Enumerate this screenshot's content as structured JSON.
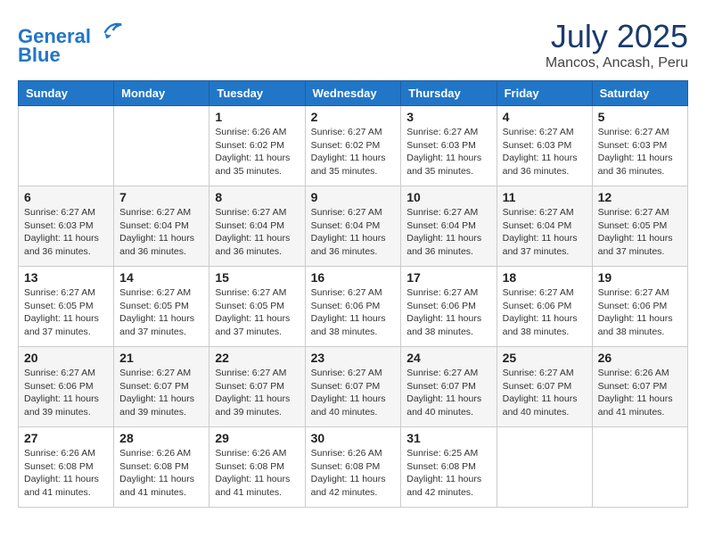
{
  "header": {
    "logo_line1": "General",
    "logo_line2": "Blue",
    "month": "July 2025",
    "location": "Mancos, Ancash, Peru"
  },
  "weekdays": [
    "Sunday",
    "Monday",
    "Tuesday",
    "Wednesday",
    "Thursday",
    "Friday",
    "Saturday"
  ],
  "weeks": [
    [
      {
        "day": "",
        "info": ""
      },
      {
        "day": "",
        "info": ""
      },
      {
        "day": "1",
        "info": "Sunrise: 6:26 AM\nSunset: 6:02 PM\nDaylight: 11 hours and 35 minutes."
      },
      {
        "day": "2",
        "info": "Sunrise: 6:27 AM\nSunset: 6:02 PM\nDaylight: 11 hours and 35 minutes."
      },
      {
        "day": "3",
        "info": "Sunrise: 6:27 AM\nSunset: 6:03 PM\nDaylight: 11 hours and 35 minutes."
      },
      {
        "day": "4",
        "info": "Sunrise: 6:27 AM\nSunset: 6:03 PM\nDaylight: 11 hours and 36 minutes."
      },
      {
        "day": "5",
        "info": "Sunrise: 6:27 AM\nSunset: 6:03 PM\nDaylight: 11 hours and 36 minutes."
      }
    ],
    [
      {
        "day": "6",
        "info": "Sunrise: 6:27 AM\nSunset: 6:03 PM\nDaylight: 11 hours and 36 minutes."
      },
      {
        "day": "7",
        "info": "Sunrise: 6:27 AM\nSunset: 6:04 PM\nDaylight: 11 hours and 36 minutes."
      },
      {
        "day": "8",
        "info": "Sunrise: 6:27 AM\nSunset: 6:04 PM\nDaylight: 11 hours and 36 minutes."
      },
      {
        "day": "9",
        "info": "Sunrise: 6:27 AM\nSunset: 6:04 PM\nDaylight: 11 hours and 36 minutes."
      },
      {
        "day": "10",
        "info": "Sunrise: 6:27 AM\nSunset: 6:04 PM\nDaylight: 11 hours and 36 minutes."
      },
      {
        "day": "11",
        "info": "Sunrise: 6:27 AM\nSunset: 6:04 PM\nDaylight: 11 hours and 37 minutes."
      },
      {
        "day": "12",
        "info": "Sunrise: 6:27 AM\nSunset: 6:05 PM\nDaylight: 11 hours and 37 minutes."
      }
    ],
    [
      {
        "day": "13",
        "info": "Sunrise: 6:27 AM\nSunset: 6:05 PM\nDaylight: 11 hours and 37 minutes."
      },
      {
        "day": "14",
        "info": "Sunrise: 6:27 AM\nSunset: 6:05 PM\nDaylight: 11 hours and 37 minutes."
      },
      {
        "day": "15",
        "info": "Sunrise: 6:27 AM\nSunset: 6:05 PM\nDaylight: 11 hours and 37 minutes."
      },
      {
        "day": "16",
        "info": "Sunrise: 6:27 AM\nSunset: 6:06 PM\nDaylight: 11 hours and 38 minutes."
      },
      {
        "day": "17",
        "info": "Sunrise: 6:27 AM\nSunset: 6:06 PM\nDaylight: 11 hours and 38 minutes."
      },
      {
        "day": "18",
        "info": "Sunrise: 6:27 AM\nSunset: 6:06 PM\nDaylight: 11 hours and 38 minutes."
      },
      {
        "day": "19",
        "info": "Sunrise: 6:27 AM\nSunset: 6:06 PM\nDaylight: 11 hours and 38 minutes."
      }
    ],
    [
      {
        "day": "20",
        "info": "Sunrise: 6:27 AM\nSunset: 6:06 PM\nDaylight: 11 hours and 39 minutes."
      },
      {
        "day": "21",
        "info": "Sunrise: 6:27 AM\nSunset: 6:07 PM\nDaylight: 11 hours and 39 minutes."
      },
      {
        "day": "22",
        "info": "Sunrise: 6:27 AM\nSunset: 6:07 PM\nDaylight: 11 hours and 39 minutes."
      },
      {
        "day": "23",
        "info": "Sunrise: 6:27 AM\nSunset: 6:07 PM\nDaylight: 11 hours and 40 minutes."
      },
      {
        "day": "24",
        "info": "Sunrise: 6:27 AM\nSunset: 6:07 PM\nDaylight: 11 hours and 40 minutes."
      },
      {
        "day": "25",
        "info": "Sunrise: 6:27 AM\nSunset: 6:07 PM\nDaylight: 11 hours and 40 minutes."
      },
      {
        "day": "26",
        "info": "Sunrise: 6:26 AM\nSunset: 6:07 PM\nDaylight: 11 hours and 41 minutes."
      }
    ],
    [
      {
        "day": "27",
        "info": "Sunrise: 6:26 AM\nSunset: 6:08 PM\nDaylight: 11 hours and 41 minutes."
      },
      {
        "day": "28",
        "info": "Sunrise: 6:26 AM\nSunset: 6:08 PM\nDaylight: 11 hours and 41 minutes."
      },
      {
        "day": "29",
        "info": "Sunrise: 6:26 AM\nSunset: 6:08 PM\nDaylight: 11 hours and 41 minutes."
      },
      {
        "day": "30",
        "info": "Sunrise: 6:26 AM\nSunset: 6:08 PM\nDaylight: 11 hours and 42 minutes."
      },
      {
        "day": "31",
        "info": "Sunrise: 6:25 AM\nSunset: 6:08 PM\nDaylight: 11 hours and 42 minutes."
      },
      {
        "day": "",
        "info": ""
      },
      {
        "day": "",
        "info": ""
      }
    ]
  ]
}
